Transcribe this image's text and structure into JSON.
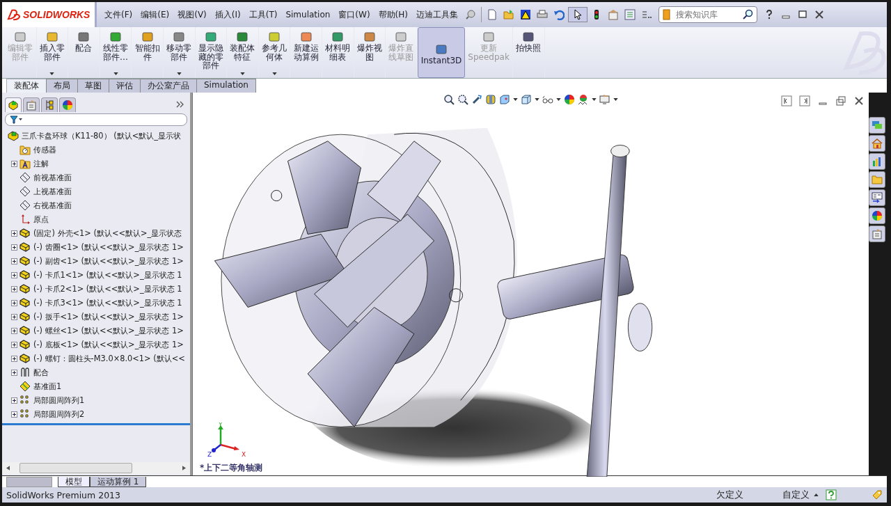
{
  "app": {
    "logo_text": "SOLIDWORKS"
  },
  "menu": [
    "文件(F)",
    "编辑(E)",
    "视图(V)",
    "插入(I)",
    "工具(T)",
    "Simulation",
    "窗口(W)",
    "帮助(H)",
    "迈迪工具集"
  ],
  "search": {
    "placeholder": "搜索知识库"
  },
  "ribbon": [
    {
      "label": "编辑零部件",
      "disabled": true,
      "dropdown": false,
      "selected": false
    },
    {
      "label": "插入零部件",
      "disabled": false,
      "dropdown": true,
      "selected": false
    },
    {
      "label": "配合",
      "disabled": false,
      "dropdown": false,
      "selected": false
    },
    {
      "label": "线性零部件…",
      "disabled": false,
      "dropdown": true,
      "selected": false
    },
    {
      "label": "智能扣件",
      "disabled": false,
      "dropdown": false,
      "selected": false
    },
    {
      "label": "移动零部件",
      "disabled": false,
      "dropdown": true,
      "selected": false
    },
    {
      "label": "显示隐藏的零部件",
      "disabled": false,
      "dropdown": false,
      "selected": false
    },
    {
      "label": "装配体特征",
      "disabled": false,
      "dropdown": true,
      "selected": false
    },
    {
      "label": "参考几何体",
      "disabled": false,
      "dropdown": true,
      "selected": false
    },
    {
      "label": "新建运动算例",
      "disabled": false,
      "dropdown": false,
      "selected": false
    },
    {
      "label": "材料明细表",
      "disabled": false,
      "dropdown": false,
      "selected": false
    },
    {
      "label": "爆炸视图",
      "disabled": false,
      "dropdown": false,
      "selected": false
    },
    {
      "label": "爆炸直线草图",
      "disabled": true,
      "dropdown": false,
      "selected": false
    },
    {
      "label": "Instant3D",
      "disabled": false,
      "dropdown": false,
      "selected": true
    },
    {
      "label": "更新\nSpeedpak",
      "disabled": true,
      "dropdown": false,
      "selected": false
    },
    {
      "label": "拍快照",
      "disabled": false,
      "dropdown": false,
      "selected": false
    }
  ],
  "command_tabs": [
    {
      "label": "装配体",
      "selected": true
    },
    {
      "label": "布局",
      "selected": false
    },
    {
      "label": "草图",
      "selected": false
    },
    {
      "label": "评估",
      "selected": false
    },
    {
      "label": "办公室产品",
      "selected": false
    },
    {
      "label": "Simulation",
      "selected": false
    }
  ],
  "feature_tree": {
    "root": {
      "label": "三爪卡盘环球（K11-80） (默认<默认_显示状",
      "expanded": true,
      "children": [
        {
          "kind": "sensor",
          "label": "传感器",
          "expandable": false
        },
        {
          "kind": "annotation",
          "label": "注解",
          "expandable": true
        },
        {
          "kind": "plane",
          "label": "前视基准面",
          "expandable": false
        },
        {
          "kind": "plane",
          "label": "上视基准面",
          "expandable": false
        },
        {
          "kind": "plane",
          "label": "右视基准面",
          "expandable": false
        },
        {
          "kind": "origin",
          "label": "原点",
          "expandable": false
        },
        {
          "kind": "part",
          "label": "(固定) 外壳<1> (默认<<默认>_显示状态",
          "expandable": true
        },
        {
          "kind": "part",
          "label": "(-) 齿圈<1> (默认<<默认>_显示状态 1>",
          "expandable": true
        },
        {
          "kind": "part",
          "label": "(-) 副齿<1> (默认<<默认>_显示状态 1>",
          "expandable": true
        },
        {
          "kind": "part",
          "label": "(-) 卡爪1<1> (默认<<默认>_显示状态 1",
          "expandable": true
        },
        {
          "kind": "part",
          "label": "(-) 卡爪2<1> (默认<<默认>_显示状态 1",
          "expandable": true
        },
        {
          "kind": "part",
          "label": "(-) 卡爪3<1> (默认<<默认>_显示状态 1",
          "expandable": true
        },
        {
          "kind": "part",
          "label": "(-) 扳手<1> (默认<<默认>_显示状态 1>",
          "expandable": true
        },
        {
          "kind": "part",
          "label": "(-) 螺丝<1> (默认<<默认>_显示状态 1>",
          "expandable": true
        },
        {
          "kind": "part",
          "label": "(-) 底板<1> (默认<<默认>_显示状态 1>",
          "expandable": true
        },
        {
          "kind": "part",
          "label": "(-) 螺钉：圆柱头-M3.0×8.0<1> (默认<<",
          "expandable": true
        },
        {
          "kind": "mates",
          "label": "配合",
          "expandable": true
        },
        {
          "kind": "refplane",
          "label": "基准面1",
          "expandable": false
        },
        {
          "kind": "pattern",
          "label": "局部圆周阵列1",
          "expandable": true
        },
        {
          "kind": "pattern",
          "label": "局部圆周阵列2",
          "expandable": true
        }
      ]
    }
  },
  "viewport": {
    "view_name": "*上下二等角轴测",
    "triad": {
      "y": "Y",
      "z": "Z",
      "x": "X"
    }
  },
  "bottom_tabs": [
    {
      "label": "模型",
      "selected": true
    },
    {
      "label": "运动算例 1",
      "selected": false
    }
  ],
  "status_bar": {
    "product": "SolidWorks Premium 2013",
    "state": "欠定义",
    "units": "自定义"
  }
}
